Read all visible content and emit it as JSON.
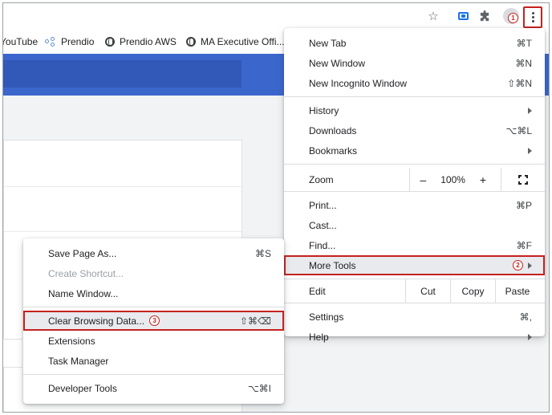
{
  "toolbar": {
    "profile_badge": "1"
  },
  "bookmarks": [
    {
      "label": "YouTube"
    },
    {
      "label": "Prendio"
    },
    {
      "label": "Prendio AWS"
    },
    {
      "label": "MA Executive Offi..."
    }
  ],
  "main_menu": {
    "new_tab": {
      "label": "New Tab",
      "shortcut": "⌘T"
    },
    "new_window": {
      "label": "New Window",
      "shortcut": "⌘N"
    },
    "new_incognito": {
      "label": "New Incognito Window",
      "shortcut": "⇧⌘N"
    },
    "history": {
      "label": "History"
    },
    "downloads": {
      "label": "Downloads",
      "shortcut": "⌥⌘L"
    },
    "bookmarks": {
      "label": "Bookmarks"
    },
    "zoom": {
      "label": "Zoom",
      "minus": "–",
      "value": "100%",
      "plus": "+"
    },
    "print": {
      "label": "Print...",
      "shortcut": "⌘P"
    },
    "cast": {
      "label": "Cast..."
    },
    "find": {
      "label": "Find...",
      "shortcut": "⌘F"
    },
    "more_tools": {
      "label": "More Tools",
      "badge": "2"
    },
    "edit": {
      "label": "Edit",
      "cut": "Cut",
      "copy": "Copy",
      "paste": "Paste"
    },
    "settings": {
      "label": "Settings",
      "shortcut": "⌘,"
    },
    "help": {
      "label": "Help"
    }
  },
  "sub_menu": {
    "save_page": {
      "label": "Save Page As...",
      "shortcut": "⌘S"
    },
    "create_shortcut": {
      "label": "Create Shortcut..."
    },
    "name_window": {
      "label": "Name Window..."
    },
    "clear_browsing": {
      "label": "Clear Browsing Data...",
      "badge": "3",
      "shortcut": "⇧⌘⌫"
    },
    "extensions": {
      "label": "Extensions"
    },
    "task_manager": {
      "label": "Task Manager"
    },
    "developer_tools": {
      "label": "Developer Tools",
      "shortcut": "⌥⌘I"
    }
  },
  "colors": {
    "annotation_red": "#c5221f",
    "banner_blue": "#3b66cc",
    "accent_blue": "#1a73e8"
  }
}
